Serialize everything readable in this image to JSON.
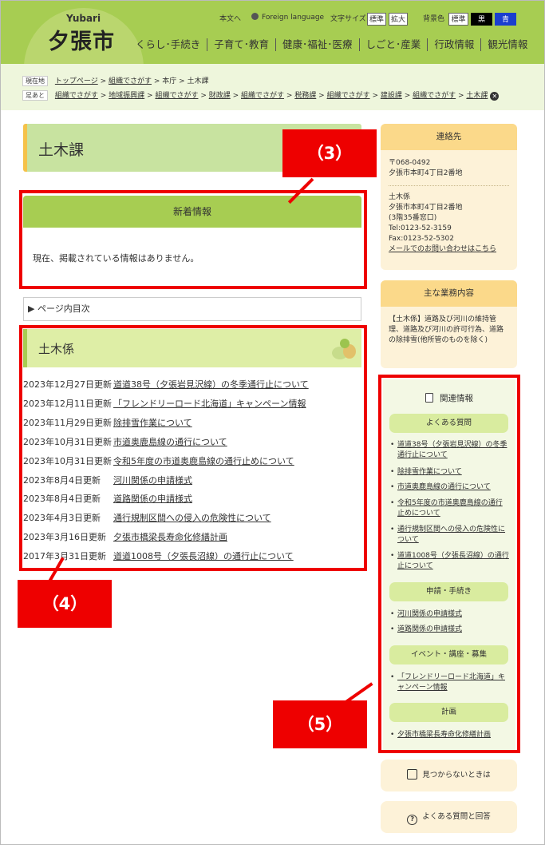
{
  "header": {
    "logo_en": "Yubari",
    "logo_jp": "夕張市",
    "text_only": "本文へ",
    "foreign_language": "Foreign language",
    "font_size_label": "文字サイズ",
    "font_std": "標準",
    "font_large": "拡大",
    "bg_label": "背景色",
    "bg_std": "標準",
    "bg_black": "黒",
    "bg_blue": "青"
  },
  "nav": [
    "くらし･手続き",
    "子育て･教育",
    "健康･福祉･医療",
    "しごと･産業",
    "行政情報",
    "観光情報"
  ],
  "breadcrumb": {
    "current_tag": "現在地",
    "current": [
      "トップページ",
      "組織でさがす",
      "本庁",
      "土木課"
    ],
    "history_tag": "足あと",
    "history": [
      "組織でさがす",
      "地域振興課",
      "組織でさがす",
      "財政課",
      "組織でさがす",
      "税務課",
      "組織でさがす",
      "建設課",
      "組織でさがす",
      "土木課"
    ]
  },
  "page_title": "土木課",
  "news": {
    "heading": "新着情報",
    "empty": "現在、掲載されている情報はありません。"
  },
  "toc": "ページ内目次",
  "section": {
    "heading": "土木係"
  },
  "updates": [
    {
      "date": "2023年12月27日更新",
      "title": "道道38号（夕張岩見沢線）の冬季通行止について"
    },
    {
      "date": "2023年12月11日更新",
      "title": "「フレンドリーロード北海道」キャンペーン情報"
    },
    {
      "date": "2023年11月29日更新",
      "title": "除排雪作業について"
    },
    {
      "date": "2023年10月31日更新",
      "title": "市道奥鹿島線の通行について"
    },
    {
      "date": "2023年10月31日更新",
      "title": "令和5年度の市道奥鹿島線の通行止めについて"
    },
    {
      "date": "2023年8月4日更新",
      "title": "河川関係の申請様式"
    },
    {
      "date": "2023年8月4日更新",
      "title": "道路関係の申請様式"
    },
    {
      "date": "2023年4月3日更新",
      "title": "通行規制区間への侵入の危険性について"
    },
    {
      "date": "2023年3月16日更新",
      "title": "夕張市橋梁長寿命化修繕計画"
    },
    {
      "date": "2017年3月31日更新",
      "title": "道道1008号（夕張長沼線）の通行止について"
    }
  ],
  "contact": {
    "heading": "連絡先",
    "postal": "〒068-0492",
    "address": "夕張市本町4丁目2番地",
    "dept": "土木係",
    "dept_address": "夕張市本町4丁目2番地",
    "window": "(3階35番窓口)",
    "tel": "Tel:0123-52-3159",
    "fax": "Fax:0123-52-5302",
    "mail": "メールでのお問い合わせはこちら"
  },
  "duties": {
    "heading": "主な業務内容",
    "text": "【土木係】道路及び河川の維持管理、道路及び河川の許可行為、道路の除排雪(他所管のものを除く)"
  },
  "related": {
    "heading": "関連情報",
    "faq_label": "よくある質問",
    "faq": [
      "道道38号（夕張岩見沢線）の冬季通行止について",
      "除排雪作業について",
      "市道奥鹿島線の通行について",
      "令和5年度の市道奥鹿島線の通行止めについて",
      "通行規制区間への侵入の危険性について",
      "道道1008号（夕張長沼線）の通行止について"
    ],
    "apply_label": "申請・手続き",
    "apply": [
      "河川関係の申請様式",
      "道路関係の申請様式"
    ],
    "event_label": "イベント・講座・募集",
    "event": [
      "「フレンドリーロード北海道」キャンペーン情報"
    ],
    "plan_label": "計画",
    "plan": [
      "夕張市橋梁長寿命化修繕計画"
    ]
  },
  "buttons": {
    "not_found": "見つからないときは",
    "faq": "よくある質問と回答"
  },
  "annotations": {
    "a3": "（3）",
    "a4": "（4）",
    "a5": "（5）"
  },
  "colors": {
    "header_green": "#a7cd52",
    "annotation_red": "#ee0000",
    "side_cream": "#fdf2d8"
  }
}
